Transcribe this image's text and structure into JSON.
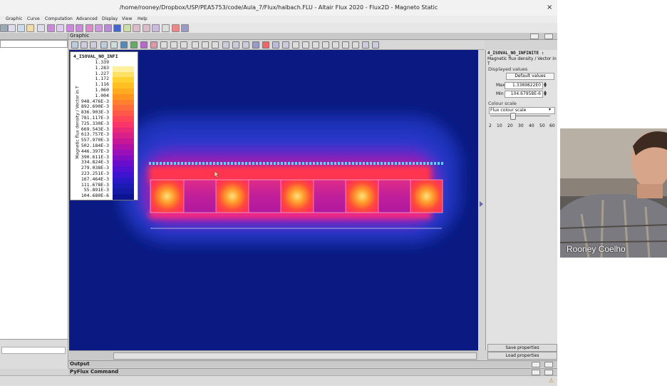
{
  "window": {
    "title": "/home/rooney/Dropbox/USP/PEA5753/code/Aula_7/Flux/halbach.FLU - Altair Flux 2020 - Flux2D - Magneto Static",
    "close_label": "×"
  },
  "menu": [
    "Graphic",
    "Curve",
    "Computation",
    "Advanced",
    "Display",
    "View",
    "Help"
  ],
  "graphic_panel": {
    "label": "Graphic"
  },
  "legend": {
    "title": "4_ISOVAL_NO_INFI",
    "caption": "Magnetic flux density / Vector in T",
    "values": [
      "1.339",
      "1.283",
      "1.227",
      "1.172",
      "1.116",
      "1.060",
      "1.004",
      "948.476E-3",
      "892.690E-3",
      "836.903E-3",
      "781.117E-3",
      "725.330E-3",
      "669.543E-3",
      "613.757E-3",
      "557.970E-3",
      "502.184E-3",
      "446.397E-3",
      "390.611E-3",
      "334.824E-3",
      "279.038E-3",
      "223.251E-3",
      "167.464E-3",
      "111.678E-3",
      "55.891E-3",
      "104.680E-6"
    ],
    "colors": [
      "#ffffff",
      "#fff0a0",
      "#ffe066",
      "#ffd030",
      "#ffbf20",
      "#ffaa20",
      "#ff9420",
      "#ff8030",
      "#ff6c3c",
      "#ff5848",
      "#ff4458",
      "#f83468",
      "#e82878",
      "#d82088",
      "#c61896",
      "#b012a8",
      "#9a10b8",
      "#820ec4",
      "#6a0ccc",
      "#5410d0",
      "#3e14d0",
      "#2a18c4",
      "#1c1cb4",
      "#141aa4",
      "#0c1494"
    ]
  },
  "properties": {
    "title": "4_ISOVAL_NO_INFINITE :",
    "subtitle": "Magnetic flux density / Vector in T",
    "displayed_values_label": "Displayed values",
    "default_values_button": "Default values",
    "max_label": "Max",
    "max_value": "1.3389822E0",
    "min_label": "Min",
    "min_value": "104.67958E-6",
    "colour_scale_label": "Colour scale",
    "colour_scale_option": "Flux colour scale",
    "scale_ticks": [
      "2",
      "10",
      "20",
      "30",
      "40",
      "50",
      "60"
    ],
    "save_button": "Save properties",
    "load_button": "Load properties"
  },
  "bottom": {
    "output_label": "Output",
    "pyflux_label": "PyFlux Command"
  },
  "webcam": {
    "participant_name": "Rooney Coelho"
  },
  "colors": {
    "background": "#0a1a82",
    "plot_field_high": "#ffe27a",
    "plot_field_mid": "#ff3f5a",
    "plot_field_low": "#5a10c8"
  }
}
